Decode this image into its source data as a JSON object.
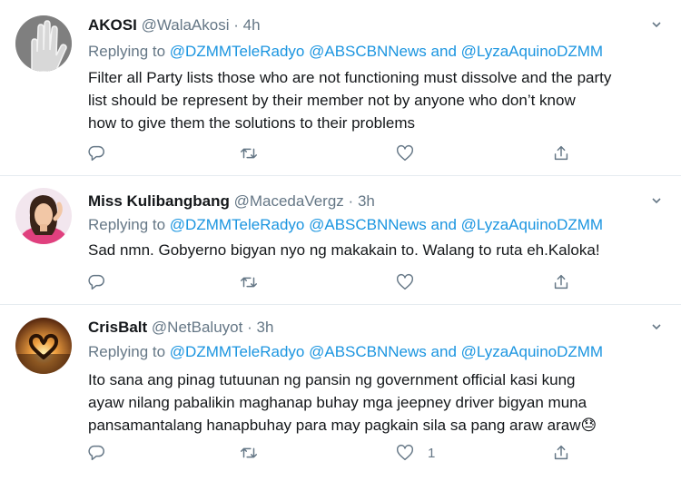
{
  "tweets": [
    {
      "name": "AKOSI",
      "handle": "@WalaAkosi",
      "dot": "·",
      "time": "4h",
      "reply_prefix": "Replying to",
      "mention1": "@DZMMTeleRadyo",
      "mention2": "@ABSCBNNews",
      "and": "and",
      "mention3": "@LyzaAquinoDZMM",
      "lines": [
        "Filter all Party lists those who are not functioning must dissolve and the party",
        "list should be represent by their member not by anyone who don’t know",
        "how to give them the solutions to their problems"
      ],
      "like_count": ""
    },
    {
      "name": "Miss Kulibangbang",
      "handle": "@MacedaVergz",
      "dot": "·",
      "time": "3h",
      "reply_prefix": "Replying to",
      "mention1": "@DZMMTeleRadyo",
      "mention2": "@ABSCBNNews",
      "and": "and",
      "mention3": "@LyzaAquinoDZMM",
      "lines": [
        "Sad nmn. Gobyerno bigyan nyo ng makakain to. Walang to ruta eh.Kaloka!"
      ],
      "like_count": ""
    },
    {
      "name": "CrisBalt",
      "handle": "@NetBaluyot",
      "dot": "·",
      "time": "3h",
      "reply_prefix": "Replying to",
      "mention1": "@DZMMTeleRadyo",
      "mention2": "@ABSCBNNews",
      "and": "and",
      "mention3": "@LyzaAquinoDZMM",
      "lines": [
        "Ito sana ang pinag tutuunan ng pansin ng government official kasi kung",
        "ayaw nilang pabalikin maghanap buhay mga jeepney driver bigyan muna",
        "pansamantalang hanapbuhay para may pagkain sila sa pang araw araw😓"
      ],
      "like_count": "1"
    }
  ],
  "icons": {
    "reply": "reply-icon",
    "retweet": "retweet-icon",
    "like": "heart-icon",
    "share": "share-icon",
    "more": "chevron-down-icon"
  },
  "colors": {
    "mention": "#1b95e0",
    "secondary_text": "#657786",
    "divider": "#e6ecf0"
  }
}
